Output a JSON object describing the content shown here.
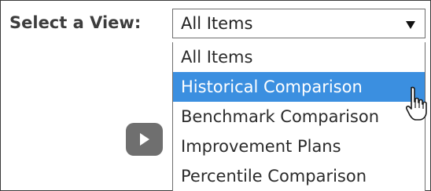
{
  "view_selector": {
    "label": "Select a View:",
    "selected_value": "All Items",
    "options": [
      {
        "label": "All Items"
      },
      {
        "label": "Historical Comparison"
      },
      {
        "label": "Benchmark Comparison"
      },
      {
        "label": "Improvement Plans"
      },
      {
        "label": "Percentile Comparison"
      }
    ],
    "highlighted_option": "Historical Comparison"
  },
  "icons": {
    "dropdown": "dropdown-arrow-icon",
    "play": "play-icon",
    "cursor": "hand-pointer-cursor-icon"
  },
  "colors": {
    "highlight": "#3b8fe0",
    "play_button": "#6f6f6f",
    "label_text": "#3d3d3d"
  }
}
